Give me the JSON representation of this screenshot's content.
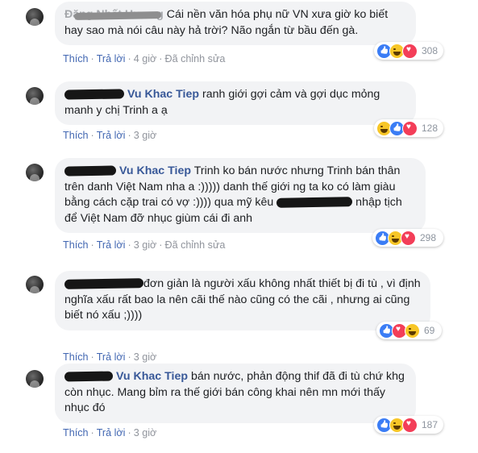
{
  "actions": {
    "like": "Thích",
    "reply": "Trả lời",
    "edited": "Đã chỉnh sửa",
    "separator": "·"
  },
  "comments": [
    {
      "text": "Cái nền văn hóa phụ nữ VN xưa giờ ko biết hay sao mà nói câu này hả trời? Não ngắn từ bầu đến gà.",
      "time": "4 giờ",
      "edited": true,
      "reaction_count": "308",
      "reactions": [
        "like-icon",
        "haha-icon",
        "love-icon"
      ]
    },
    {
      "tagged": "Vu Khac Tiep",
      "text": " ranh giới gợi cảm và gợi dục mỏng manh y chị Trinh a ạ",
      "time": "3 giờ",
      "edited": false,
      "reaction_count": "128",
      "reactions": [
        "haha-icon",
        "like-icon",
        "love-icon"
      ]
    },
    {
      "tagged": "Vu Khac Tiep",
      "text": " Trinh ko bán nước nhưng Trinh bán thân trên danh Việt Nam nha a :))))) danh thế giới ng ta ko có làm giàu bằng cách cặp trai có vợ :)))) qua mỹ kêu",
      "text2": " nhập tịch để Việt Nam đỡ nhục giùm cái đi anh",
      "time": "3 giờ",
      "edited": true,
      "reaction_count": "298",
      "reactions": [
        "like-icon",
        "haha-icon",
        "love-icon"
      ]
    },
    {
      "text": "đơn giản là người xấu không nhất thiết bị đi tù , vì định nghĩa xấu rất bao la nên cãi thế nào cũng có the cãi , nhưng ai cũng biết nó xấu ;))))",
      "time": "3 giờ",
      "edited": false,
      "reaction_count": "69",
      "reactions": [
        "like-icon",
        "love-icon",
        "haha-icon"
      ]
    },
    {
      "tagged": "Vu Khac Tiep",
      "text": " bán nước, phản động thif đã đi tù chứ khg còn nhục. Mang bỉm ra thế giới bán công khai nên mn mới thấy nhục đó",
      "time": "3 giờ",
      "edited": false,
      "reaction_count": "187",
      "reactions": [
        "like-icon",
        "haha-icon",
        "love-icon"
      ]
    }
  ]
}
